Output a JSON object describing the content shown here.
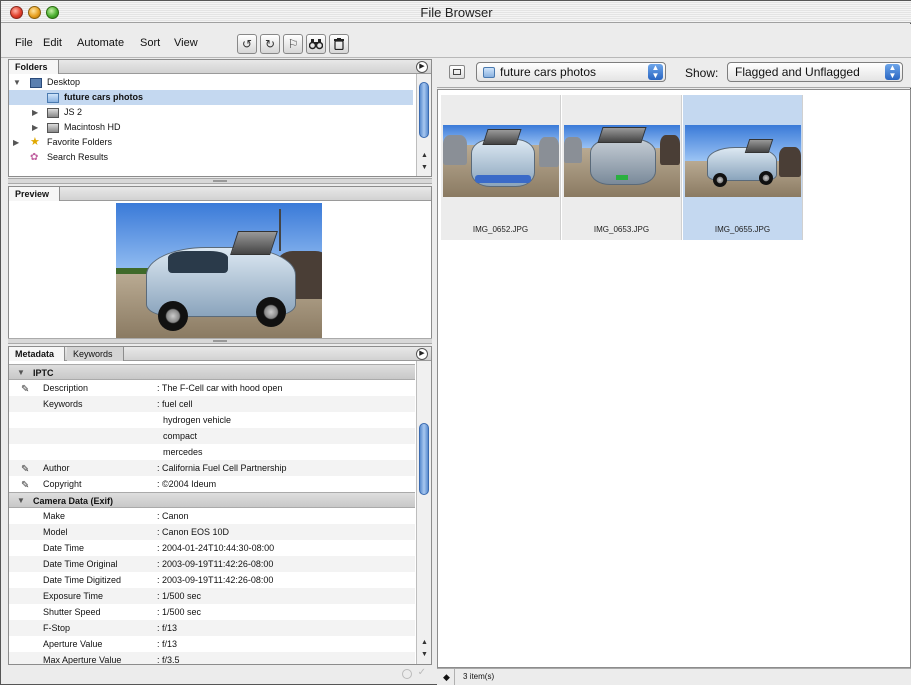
{
  "window": {
    "title": "File Browser"
  },
  "menu": {
    "items": [
      "File",
      "Edit",
      "Automate",
      "Sort",
      "View"
    ]
  },
  "toolbar": {
    "icons": [
      "rotate-ccw-icon",
      "rotate-cw-icon",
      "flag-icon",
      "binoculars-icon",
      "trash-icon"
    ]
  },
  "folders": {
    "tab_label": "Folders",
    "items": [
      {
        "label": "Desktop",
        "expanded": true,
        "icon": "desktop-icon",
        "indent": 0
      },
      {
        "label": "future cars photos",
        "selected": true,
        "icon": "folder-icon",
        "indent": 1
      },
      {
        "label": "JS 2",
        "icon": "disk-icon",
        "indent": 1
      },
      {
        "label": "Macintosh HD",
        "icon": "disk-icon",
        "indent": 1
      },
      {
        "label": "Favorite Folders",
        "icon": "star-icon",
        "indent": 0
      },
      {
        "label": "Search Results",
        "icon": "search-results-icon",
        "indent": 0
      }
    ]
  },
  "preview": {
    "tab_label": "Preview"
  },
  "metadata": {
    "tabs": [
      "Metadata",
      "Keywords"
    ],
    "sections": [
      {
        "title": "IPTC",
        "rows": [
          {
            "key": "Description",
            "value": ": The F-Cell car with hood open",
            "editable": true
          },
          {
            "key": "Keywords",
            "value": ": fuel cell",
            "editable": false
          },
          {
            "key": "",
            "value": "hydrogen vehicle",
            "editable": false
          },
          {
            "key": "",
            "value": "compact",
            "editable": false
          },
          {
            "key": "",
            "value": "mercedes",
            "editable": false
          },
          {
            "key": "Author",
            "value": ": California Fuel Cell Partnership",
            "editable": true
          },
          {
            "key": "Copyright",
            "value": ": ©2004 Ideum",
            "editable": true
          }
        ]
      },
      {
        "title": "Camera Data (Exif)",
        "rows": [
          {
            "key": "Make",
            "value": ": Canon"
          },
          {
            "key": "Model",
            "value": ": Canon EOS 10D"
          },
          {
            "key": "Date Time",
            "value": ": 2004-01-24T10:44:30-08:00"
          },
          {
            "key": "Date Time Original",
            "value": ": 2003-09-19T11:42:26-08:00"
          },
          {
            "key": "Date Time Digitized",
            "value": ": 2003-09-19T11:42:26-08:00"
          },
          {
            "key": "Exposure Time",
            "value": ": 1/500 sec"
          },
          {
            "key": "Shutter Speed",
            "value": ": 1/500 sec"
          },
          {
            "key": "F-Stop",
            "value": ": f/13"
          },
          {
            "key": "Aperture Value",
            "value": ": f/13"
          },
          {
            "key": "Max Aperture Value",
            "value": ": f/3.5"
          }
        ]
      }
    ]
  },
  "browser": {
    "location": "future cars photos",
    "show_label": "Show:",
    "show_value": "Flagged and Unflagged",
    "thumbnails": [
      {
        "filename": "IMG_0652.JPG",
        "selected": false
      },
      {
        "filename": "IMG_0653.JPG",
        "selected": false
      },
      {
        "filename": "IMG_0655.JPG",
        "selected": true
      }
    ],
    "status": "3 item(s)"
  },
  "colors": {
    "selection": "#c4d8f0",
    "accent": "#2a66c2"
  }
}
